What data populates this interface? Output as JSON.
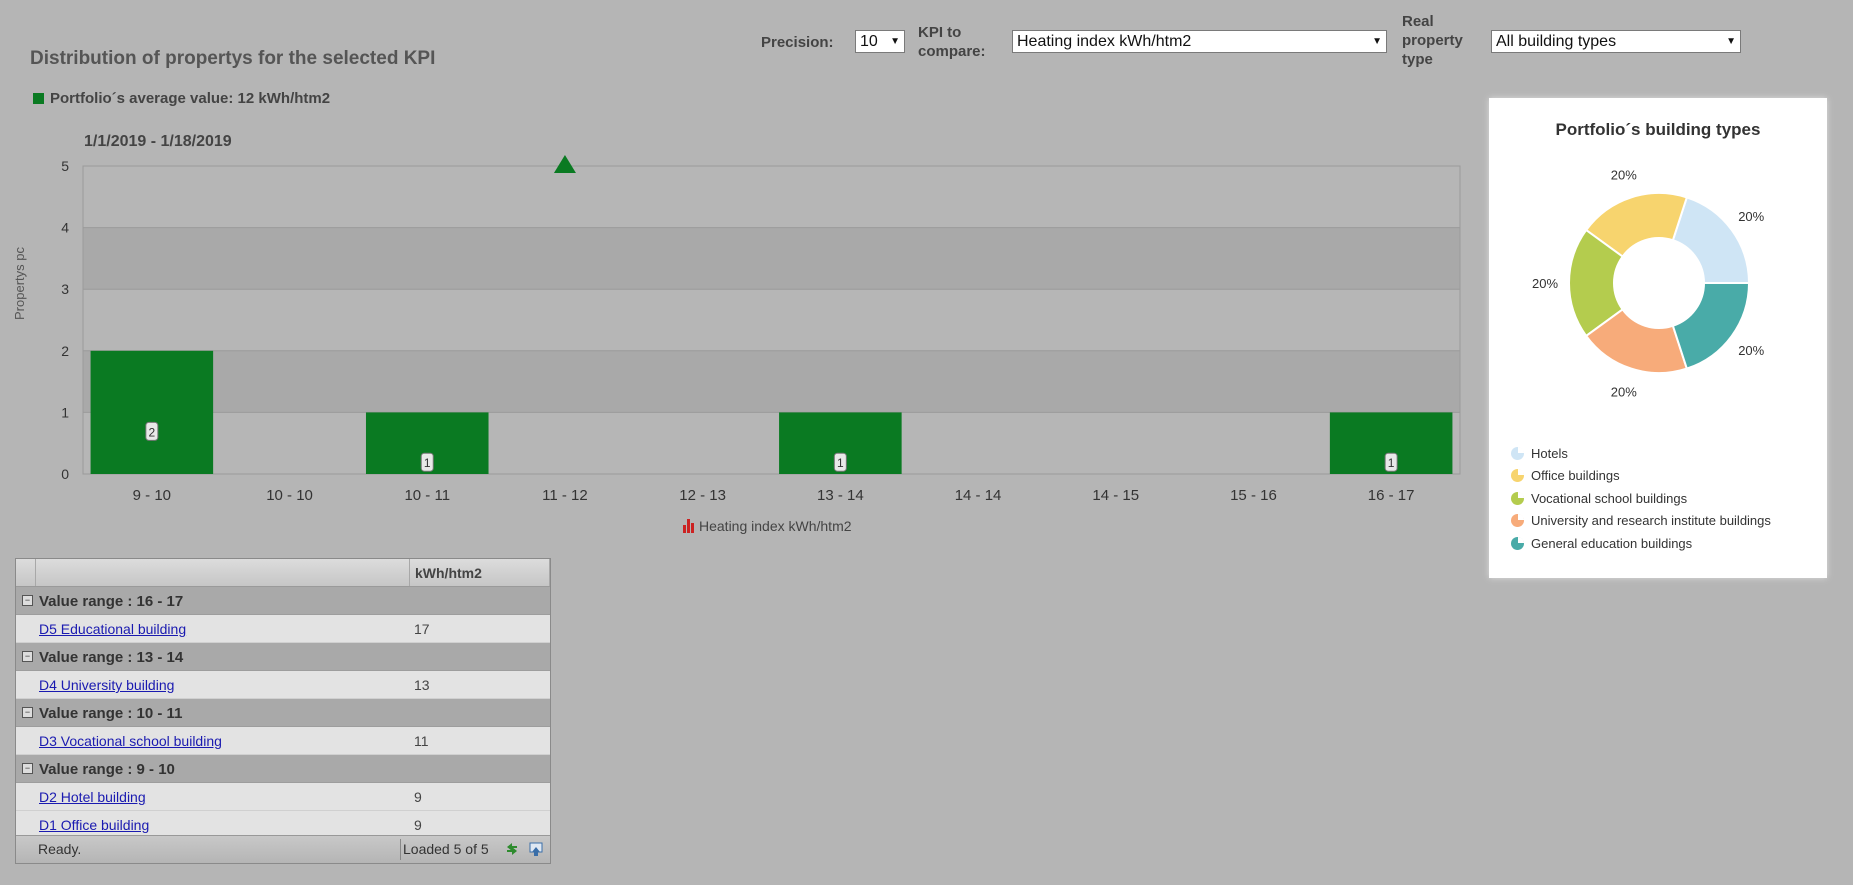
{
  "header": {
    "title": "Distribution of propertys for the selected KPI",
    "average_legend": "Portfolio´s average value: 12 kWh/htm2",
    "average_color": "#0a7a22"
  },
  "toolbar": {
    "precision_label": "Precision:",
    "precision_value": "10",
    "kpi_label_line1": "KPI to",
    "kpi_label_line2": "compare:",
    "kpi_value": "Heating index kWh/htm2",
    "property_label_line1": "Real",
    "property_label_line2": "property",
    "property_label_line3": "type",
    "property_value": "All building types"
  },
  "chart_data": [
    {
      "type": "bar",
      "title": "1/1/2019 - 1/18/2019",
      "ylabel": "Propertys pc",
      "categories": [
        "9 - 10",
        "10 - 10",
        "10 - 11",
        "11 - 12",
        "12 - 13",
        "13 - 14",
        "14 - 14",
        "14 - 15",
        "15 - 16",
        "16 - 17"
      ],
      "series": [
        {
          "name": "Heating index kWh/htm2",
          "values": [
            2,
            0,
            1,
            0,
            0,
            1,
            0,
            0,
            0,
            1
          ]
        }
      ],
      "data_labels": [
        "2",
        "",
        "1",
        "",
        "",
        "1",
        "",
        "",
        "",
        "1"
      ],
      "y_ticks": [
        "0",
        "1",
        "2",
        "3",
        "4",
        "5"
      ],
      "ylim": [
        0,
        5
      ],
      "average_marker_category": "11 - 12",
      "bar_color": "#0a7a22",
      "grid": true,
      "legend_position": "bottom"
    },
    {
      "type": "pie",
      "title": "Portfolio´s building types",
      "categories": [
        "Hotels",
        "Office buildings",
        "Vocational school buildings",
        "University and research institute buildings",
        "General education buildings"
      ],
      "values": [
        20,
        20,
        20,
        20,
        20
      ],
      "value_labels": [
        "20%",
        "20%",
        "20%",
        "20%",
        "20%"
      ],
      "colors": [
        "#cfe5f5",
        "#f7d46e",
        "#b4cc4e",
        "#f7ab7a",
        "#49aba8"
      ],
      "legend_position": "bottom"
    }
  ],
  "grid": {
    "column_header": "kWh/htm2",
    "groups": [
      {
        "label": "Value range : 16 - 17",
        "rows": [
          {
            "name": "D5 Educational building",
            "value": "17"
          }
        ]
      },
      {
        "label": "Value range : 13 - 14",
        "rows": [
          {
            "name": "D4 University building",
            "value": "13"
          }
        ]
      },
      {
        "label": "Value range : 10 - 11",
        "rows": [
          {
            "name": "D3 Vocational school building",
            "value": "11"
          }
        ]
      },
      {
        "label": "Value range : 9 - 10",
        "rows": [
          {
            "name": "D2 Hotel building",
            "value": "9"
          },
          {
            "name": "D1 Office building",
            "value": "9"
          }
        ]
      }
    ],
    "status": "Ready.",
    "loaded": "Loaded 5 of 5"
  }
}
